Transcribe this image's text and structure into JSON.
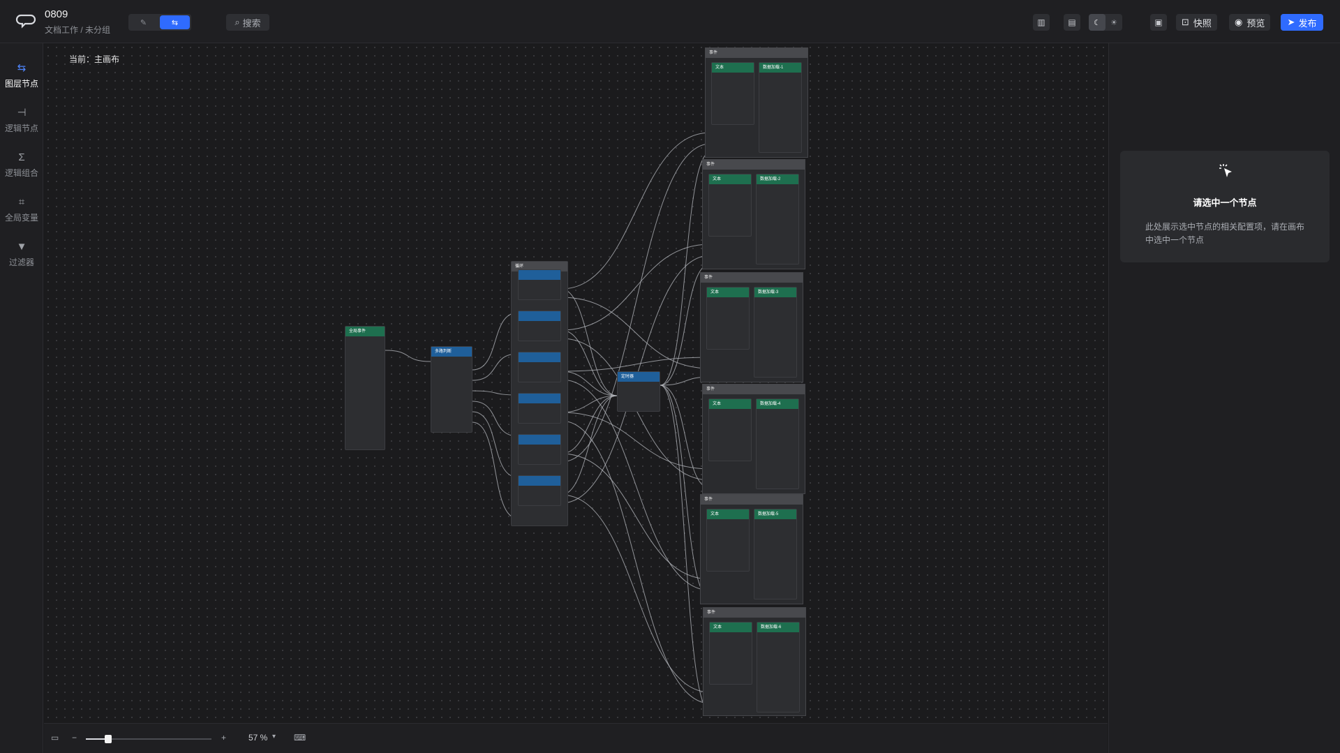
{
  "header": {
    "title": "0809",
    "subtitle": "文档工作 / 未分组",
    "search_label": "搜索",
    "snapshot_label": "快照",
    "preview_label": "预览",
    "publish_label": "发布",
    "accent_color": "#2f6bff"
  },
  "sidebar": {
    "items": [
      {
        "label": "图层节点",
        "icon": "layers-icon",
        "active": true
      },
      {
        "label": "逻辑节点",
        "icon": "logic-node-icon"
      },
      {
        "label": "逻辑组合",
        "icon": "sigma-icon"
      },
      {
        "label": "全局变量",
        "icon": "variable-icon"
      },
      {
        "label": "过滤器",
        "icon": "filter-icon"
      }
    ]
  },
  "canvas": {
    "current_label": "当前：主画布"
  },
  "nodes": {
    "left": {
      "title": "全局事件"
    },
    "router": {
      "title": "多路判断"
    },
    "column": {
      "title": "循环"
    },
    "mid": {
      "title": "定时器"
    },
    "groups": [
      {
        "title": "事件",
        "a": "文本",
        "b": "数据加载-1"
      },
      {
        "title": "事件",
        "a": "文本",
        "b": "数据加载-2"
      },
      {
        "title": "事件",
        "a": "文本",
        "b": "数据加载-3"
      },
      {
        "title": "事件",
        "a": "文本",
        "b": "数据加载-4"
      },
      {
        "title": "事件",
        "a": "文本",
        "b": "数据加载-5"
      },
      {
        "title": "事件",
        "a": "文本",
        "b": "数据加载-6"
      }
    ]
  },
  "bottom": {
    "zoom_percent": 57,
    "zoom_label": "57 %",
    "zoom_minus": "−",
    "zoom_plus": "+"
  },
  "right_panel": {
    "empty_title": "请选中一个节点",
    "empty_desc": "此处展示选中节点的相关配置项，请在画布中选中一个节点"
  }
}
